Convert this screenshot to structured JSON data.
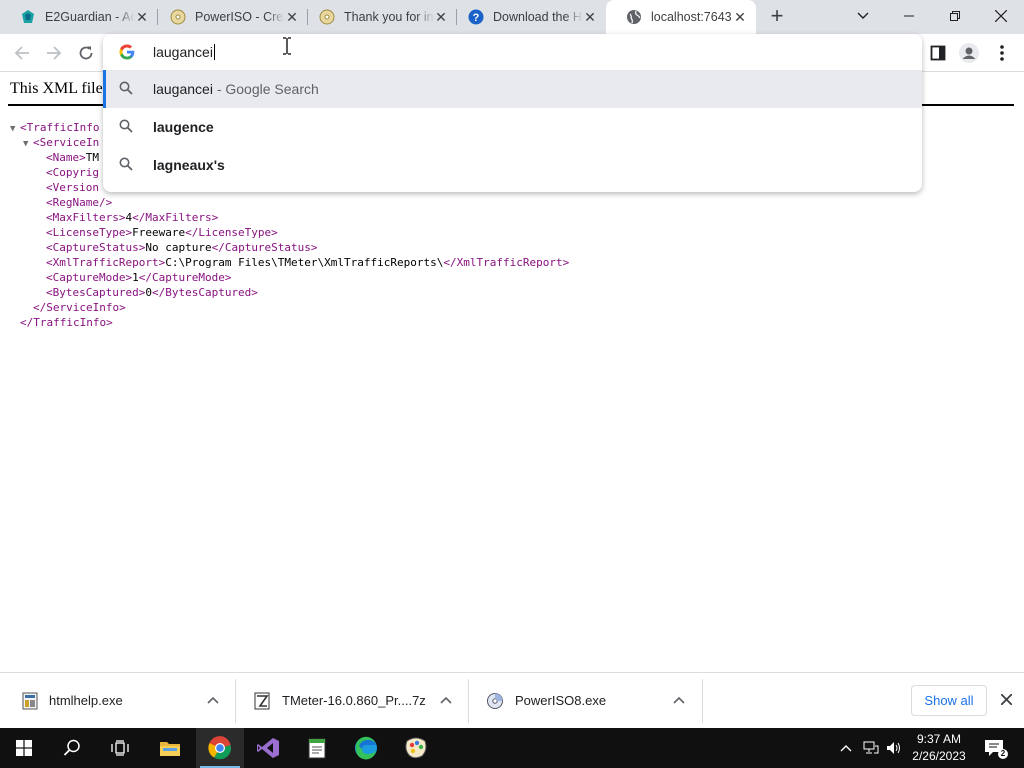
{
  "browser": {
    "tabs": [
      {
        "title": "E2Guardian - Ac",
        "icon": "e2guardian-icon"
      },
      {
        "title": "PowerISO - Crea",
        "icon": "poweriso-icon"
      },
      {
        "title": "Thank you for in",
        "icon": "poweriso-icon"
      },
      {
        "title": "Download the H",
        "icon": "help-icon"
      },
      {
        "title": "localhost:7643",
        "icon": "globe-icon",
        "active": true
      }
    ],
    "new_tab": "+"
  },
  "omnibox": {
    "input": "laugancei",
    "suggestions": [
      {
        "main": "laugancei",
        "suffix": " - Google Search",
        "selected": true
      },
      {
        "main": "laugence",
        "suffix": ""
      },
      {
        "main": "lagneaux's",
        "suffix": ""
      }
    ]
  },
  "page": {
    "xml_notice": "This XML file",
    "xml_lines": [
      {
        "indent": 0,
        "tri": "▼",
        "text": "<TrafficInfo"
      },
      {
        "indent": 1,
        "tri": "▼",
        "text": "<ServiceIn"
      },
      {
        "indent": 2,
        "tri": "",
        "text": "<Name>TM"
      },
      {
        "indent": 2,
        "tri": "",
        "text": "<Copyrig"
      },
      {
        "indent": 2,
        "tri": "",
        "text": "<Version"
      },
      {
        "indent": 2,
        "tri": "",
        "text": "<RegName/>"
      },
      {
        "indent": 2,
        "tri": "",
        "text": "<MaxFilters>4</MaxFilters>"
      },
      {
        "indent": 2,
        "tri": "",
        "text": "<LicenseType>Freeware</LicenseType>"
      },
      {
        "indent": 2,
        "tri": "",
        "text": "<CaptureStatus>No capture</CaptureStatus>"
      },
      {
        "indent": 2,
        "tri": "",
        "text": "<XmlTrafficReport>C:\\Program Files\\TMeter\\XmlTrafficReports\\</XmlTrafficReport>"
      },
      {
        "indent": 2,
        "tri": "",
        "text": "<CaptureMode>1</CaptureMode>"
      },
      {
        "indent": 2,
        "tri": "",
        "text": "<BytesCaptured>0</BytesCaptured>"
      },
      {
        "indent": 1,
        "tri": "",
        "text": "</ServiceInfo>"
      },
      {
        "indent": 0,
        "tri": "",
        "text": "</TrafficInfo>"
      }
    ]
  },
  "downloads": {
    "items": [
      {
        "name": "htmlhelp.exe",
        "icon": "exe-icon"
      },
      {
        "name": "TMeter-16.0.860_Pr....7z",
        "icon": "archive-icon"
      },
      {
        "name": "PowerISO8.exe",
        "icon": "poweriso-icon"
      }
    ],
    "show_all": "Show all"
  },
  "taskbar": {
    "apps": [
      "windows-start-icon",
      "search-icon",
      "task-view-icon",
      "file-explorer-icon",
      "chrome-icon",
      "visual-studio-icon",
      "notepad-icon",
      "edge-icon",
      "paint-icon"
    ],
    "time": "9:37 AM",
    "date": "2/26/2023"
  },
  "colors": {
    "accent": "#1a73e8",
    "xml_tag": "#881280",
    "taskbar": "#101010"
  }
}
